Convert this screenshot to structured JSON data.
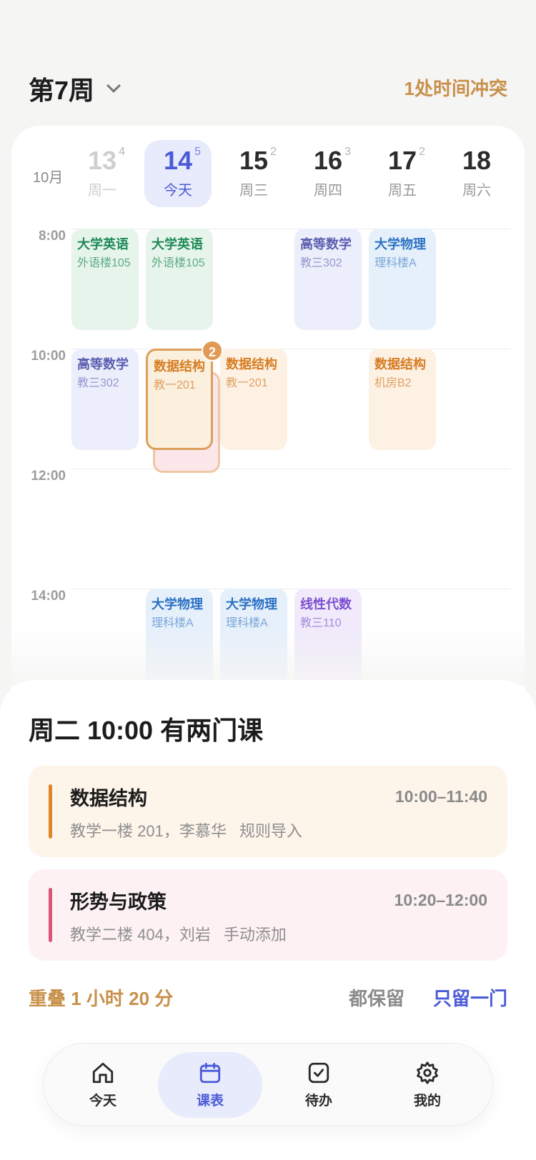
{
  "header": {
    "week_number": "第7周",
    "conflict_link": "1处时间冲突"
  },
  "calendar": {
    "month": "10月",
    "days": [
      {
        "num": "13",
        "sup": "4",
        "label": "周一"
      },
      {
        "num": "14",
        "sup": "5",
        "label": "今天"
      },
      {
        "num": "15",
        "sup": "2",
        "label": "周三"
      },
      {
        "num": "16",
        "sup": "3",
        "label": "周四"
      },
      {
        "num": "17",
        "sup": "2",
        "label": "周五"
      },
      {
        "num": "18",
        "sup": "",
        "label": "周六"
      }
    ],
    "times": [
      "8:00",
      "10:00",
      "12:00",
      "14:00"
    ],
    "events": {
      "mon_eng": {
        "title": "大学英语",
        "loc": "外语楼105"
      },
      "tue_eng": {
        "title": "大学英语",
        "loc": "外语楼105"
      },
      "thu_math": {
        "title": "高等数学",
        "loc": "教三302"
      },
      "fri_phys": {
        "title": "大学物理",
        "loc": "理科楼A"
      },
      "mon_math": {
        "title": "高等数学",
        "loc": "教三302"
      },
      "tue_ds": {
        "title": "数据结构",
        "loc": "教一201"
      },
      "wed_ds": {
        "title": "数据结构",
        "loc": "教一201"
      },
      "fri_ds": {
        "title": "数据结构",
        "loc": "机房B2"
      },
      "tue_phys": {
        "title": "大学物理",
        "loc": "理科楼A"
      },
      "wed_phys": {
        "title": "大学物理",
        "loc": "理科楼A"
      },
      "thu_linalg": {
        "title": "线性代数",
        "loc": "教三110"
      }
    },
    "conflict_badge": "2"
  },
  "sheet": {
    "title": "周二 10:00 有两门课",
    "courses": [
      {
        "name": "数据结构",
        "time": "10:00–11:40",
        "place": "教学一楼 201，李慕华",
        "source": "规则导入",
        "accent": "#e0862a"
      },
      {
        "name": "形势与政策",
        "time": "10:20–12:00",
        "place": "教学二楼 404，刘岩",
        "source": "手动添加",
        "accent": "#d9557a"
      }
    ],
    "overlap": "重叠 1 小时 20 分",
    "keep_all": "都保留",
    "keep_one": "只留一门"
  },
  "tabbar": {
    "items": [
      {
        "label": "今天",
        "icon": "home-icon"
      },
      {
        "label": "课表",
        "icon": "calendar-icon"
      },
      {
        "label": "待办",
        "icon": "checkbox-icon"
      },
      {
        "label": "我的",
        "icon": "gear-icon"
      }
    ],
    "active": "课表"
  },
  "colors": {
    "accent": "#4b5bd6",
    "warning": "#c8904a"
  }
}
